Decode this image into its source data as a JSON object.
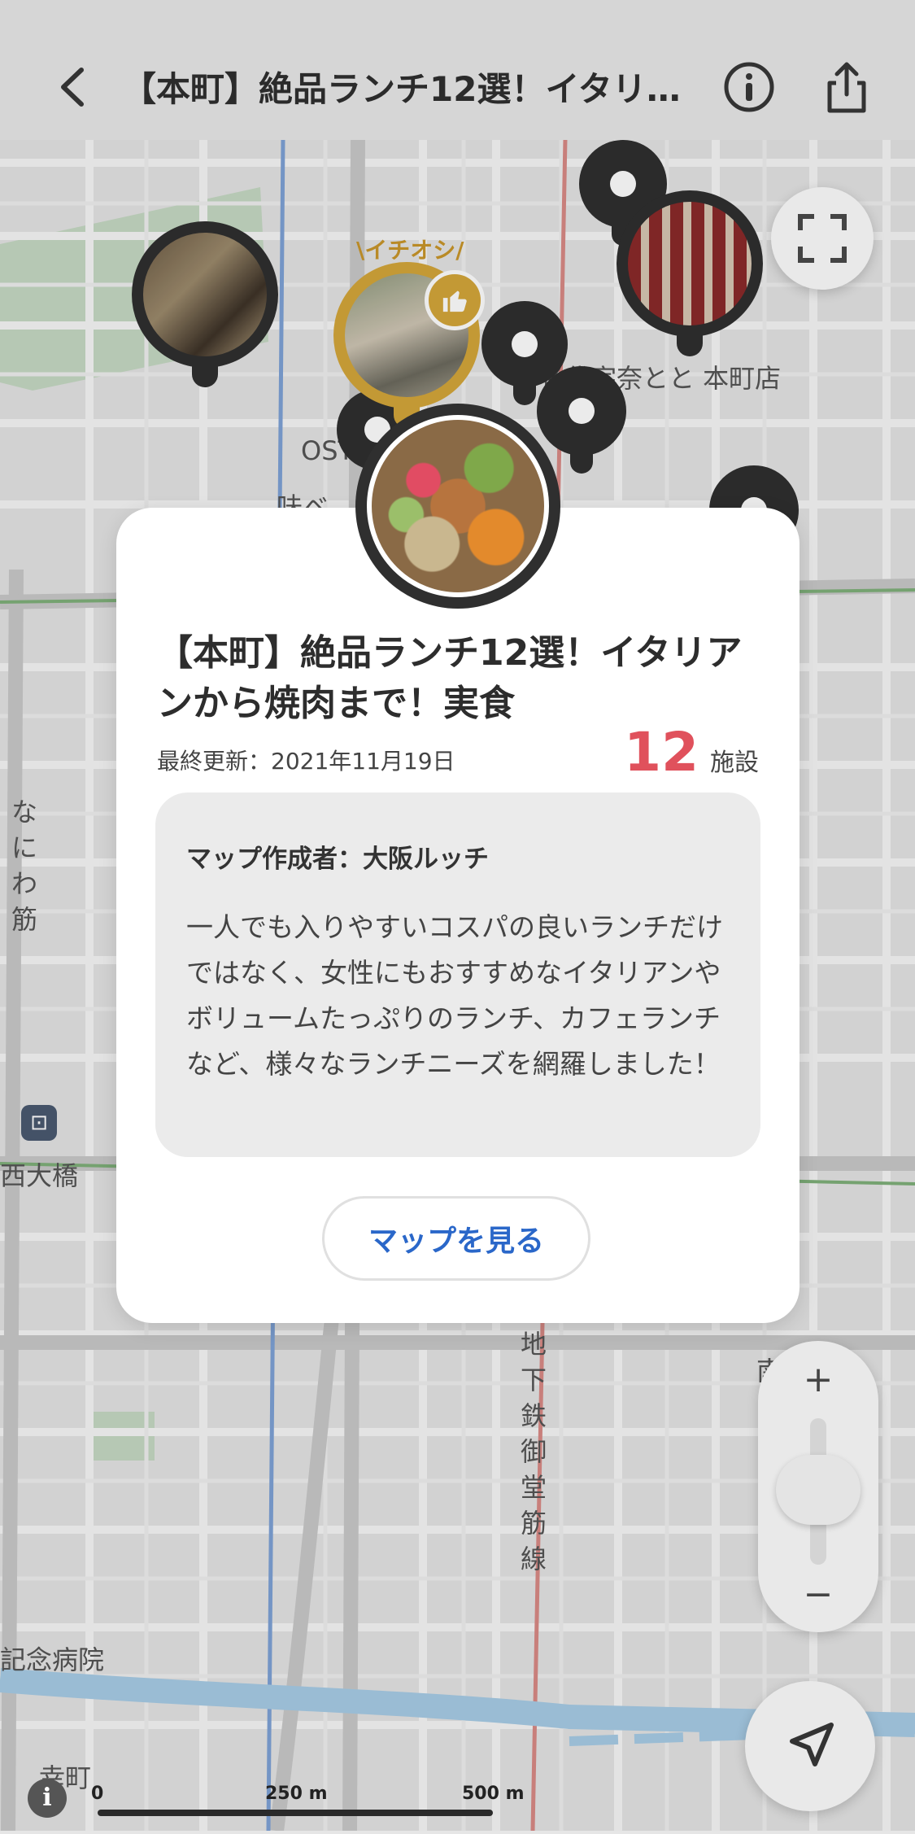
{
  "header": {
    "title": "【本町】絶品ランチ12選！イタリ…",
    "back_icon": "chevron-left-icon",
    "info_icon": "info-icon",
    "share_icon": "share-icon"
  },
  "map": {
    "labels": {
      "shop_name": "名代宇奈とと 本町店",
      "place_partial": "OSTE",
      "place_partial2": "味ベ",
      "street_naniwa": "なにわ筋",
      "station_nishiohashi": "西大橋",
      "subway_line": "地下鉄御堂筋線",
      "hospital": "記念病院",
      "area_partial": "幸町",
      "south_partial": "南"
    },
    "ichioshi_badge": "\\イチオシ/",
    "scale": {
      "zero": "0",
      "mid": "250 m",
      "end": "500 m"
    },
    "zoom": {
      "plus": "+",
      "minus": "−"
    }
  },
  "card": {
    "title": "【本町】絶品ランチ12選！イタリアンから焼肉まで！実食",
    "last_updated": "最終更新：2021年11月19日",
    "count": "12",
    "count_unit": "施設",
    "author": "マップ作成者：大阪ルッチ",
    "description": "一人でも入りやすいコスパの良いランチだけではなく、女性にもおすすめなイタリアンやボリュームたっぷりのランチ、カフェランチなど、様々なランチニーズを網羅しました！",
    "view_map_button": "マップを見る"
  },
  "colors": {
    "accent_red": "#e0515c",
    "link_blue": "#2a67c9",
    "gold": "#d4a63a",
    "pin_dark": "#2f2f2f"
  }
}
